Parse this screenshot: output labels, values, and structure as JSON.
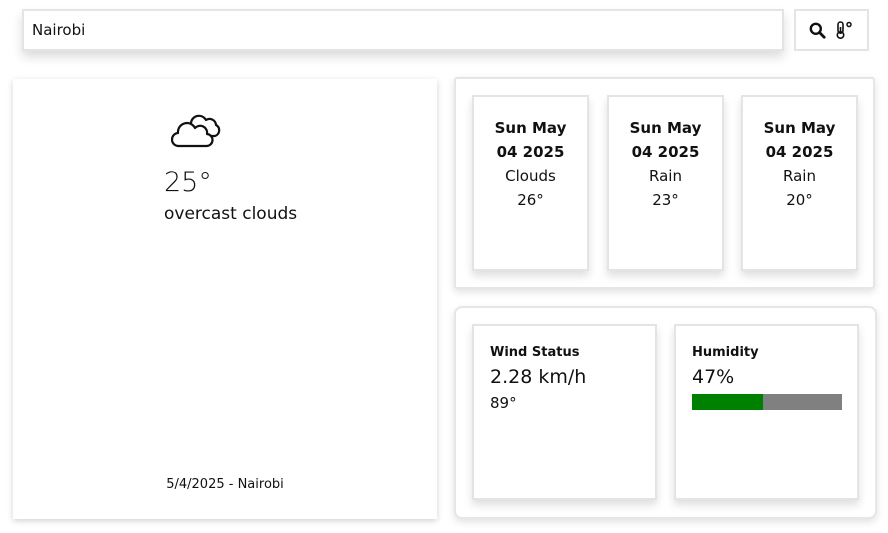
{
  "search": {
    "value": "Nairobi"
  },
  "toolbar": {
    "search_icon": "search-icon",
    "unit_icon": "thermometer-degree-icon"
  },
  "current": {
    "icon": "cloudy-icon",
    "temperature": "25°",
    "description": "overcast clouds",
    "footer": "5/4/2025 - Nairobi"
  },
  "forecast": [
    {
      "date_line1": "Sun May",
      "date_line2": "04 2025",
      "condition": "Clouds",
      "temp": "26°"
    },
    {
      "date_line1": "Sun May",
      "date_line2": "04 2025",
      "condition": "Rain",
      "temp": "23°"
    },
    {
      "date_line1": "Sun May",
      "date_line2": "04 2025",
      "condition": "Rain",
      "temp": "20°"
    }
  ],
  "wind": {
    "title": "Wind Status",
    "speed": "2.28 km/h",
    "direction": "89°"
  },
  "humidity": {
    "title": "Humidity",
    "value": "47%",
    "percent": 47,
    "fill_color": "#008000",
    "track_color": "#808080"
  }
}
